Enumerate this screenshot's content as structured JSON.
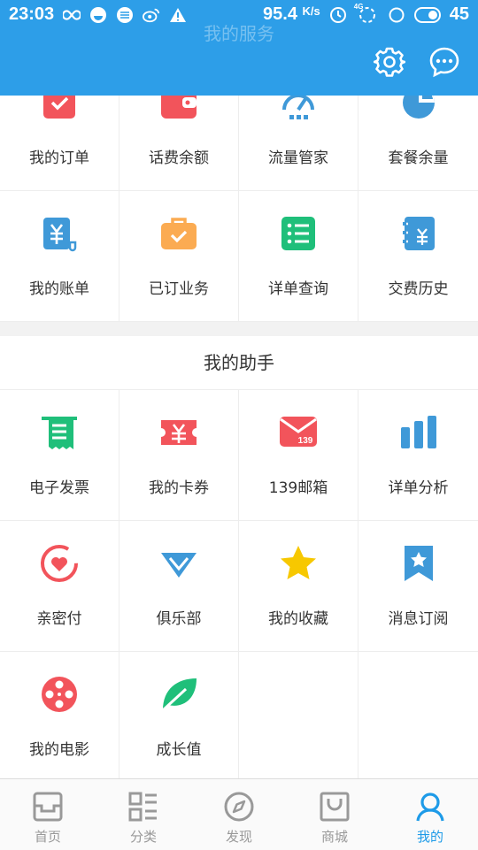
{
  "status_bar": {
    "time": "23:03",
    "speed": "95.4",
    "speed_unit": "K/s",
    "network": "4G",
    "battery": "45"
  },
  "header": {
    "faded_title": "我的服务"
  },
  "services": [
    {
      "label": "我的订单",
      "icon": "order-icon"
    },
    {
      "label": "话费余额",
      "icon": "wallet-icon"
    },
    {
      "label": "流量管家",
      "icon": "speedometer-icon"
    },
    {
      "label": "套餐余量",
      "icon": "pie-chart-icon"
    },
    {
      "label": "我的账单",
      "icon": "bill-icon"
    },
    {
      "label": "已订业务",
      "icon": "briefcase-icon"
    },
    {
      "label": "详单查询",
      "icon": "list-icon"
    },
    {
      "label": "交费历史",
      "icon": "notebook-icon"
    }
  ],
  "assistant": {
    "title": "我的助手",
    "items": [
      {
        "label": "电子发票",
        "icon": "receipt-icon"
      },
      {
        "label": "我的卡券",
        "icon": "coupon-icon"
      },
      {
        "label": "139邮箱",
        "icon": "mail-icon",
        "badge": "139"
      },
      {
        "label": "详单分析",
        "icon": "bar-chart-icon"
      },
      {
        "label": "亲密付",
        "icon": "heart-pay-icon"
      },
      {
        "label": "俱乐部",
        "icon": "diamond-icon"
      },
      {
        "label": "我的收藏",
        "icon": "star-icon"
      },
      {
        "label": "消息订阅",
        "icon": "bookmark-star-icon"
      },
      {
        "label": "我的电影",
        "icon": "film-reel-icon"
      },
      {
        "label": "成长值",
        "icon": "leaf-icon"
      }
    ]
  },
  "tabs": [
    {
      "label": "首页",
      "icon": "home-icon",
      "active": false
    },
    {
      "label": "分类",
      "icon": "category-icon",
      "active": false
    },
    {
      "label": "发现",
      "icon": "compass-icon",
      "active": false
    },
    {
      "label": "商城",
      "icon": "shop-bag-icon",
      "active": false
    },
    {
      "label": "我的",
      "icon": "user-icon",
      "active": true
    }
  ],
  "colors": {
    "header": "#2d9ee8",
    "red": "#f2545b",
    "orange": "#fbab52",
    "blue": "#3f99d8",
    "green": "#1fbf7a",
    "yellow": "#f7c800",
    "tab_active": "#1e9be8"
  }
}
